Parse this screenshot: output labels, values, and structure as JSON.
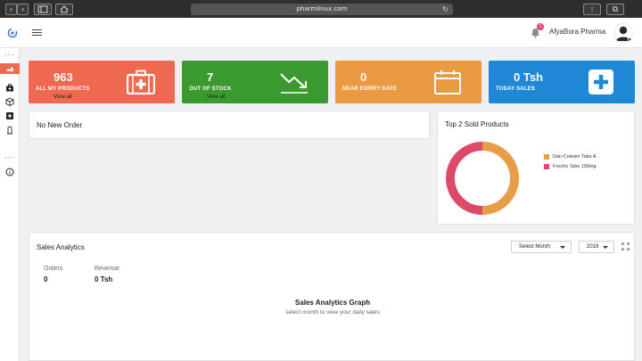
{
  "browser": {
    "url": "pharmlinux.com",
    "back_glyph": "‹",
    "forward_glyph": "›",
    "share_glyph": "↑",
    "tabs_glyph": "⧉"
  },
  "header": {
    "user_name": "AfyaBora Pharma",
    "notification_count": "1"
  },
  "cards": [
    {
      "value": "963",
      "label": "ALL MY PRODUCTS",
      "link": "View all",
      "color": "#ee694f",
      "icon": "medical-kit-icon"
    },
    {
      "value": "7",
      "label": "OUT OF STOCK",
      "link": "View all",
      "color": "#3b9a2f",
      "icon": "trend-down-icon"
    },
    {
      "value": "0",
      "label": "NEAR EXPIRY DATE",
      "link": "",
      "color": "#eb9a42",
      "icon": "calendar-icon"
    },
    {
      "value": "0 Tsh",
      "label": "TODAY SALES",
      "link": "",
      "color": "#1e88d6",
      "icon": "plus-box-icon"
    }
  ],
  "orders_panel": {
    "title": "No New Order"
  },
  "top_products": {
    "title": "Top 2 Sold Products",
    "chart_data": {
      "type": "pie",
      "series": [
        {
          "name": "Dan-Cotesin Tabs A",
          "value": 50,
          "color": "#e89c45"
        },
        {
          "name": "Frecho Tabs 100mg",
          "value": 50,
          "color": "#dd4a67"
        }
      ],
      "legend": "right"
    }
  },
  "analytics": {
    "title": "Sales Analytics",
    "month_select": "Select Month",
    "year_select": "2019",
    "orders_label": "Orders",
    "orders_value": "0",
    "revenue_label": "Revenue",
    "revenue_value": "0 Tsh",
    "graph_title": "Sales Analytics Graph",
    "graph_hint": "select month to view your daily sales"
  }
}
